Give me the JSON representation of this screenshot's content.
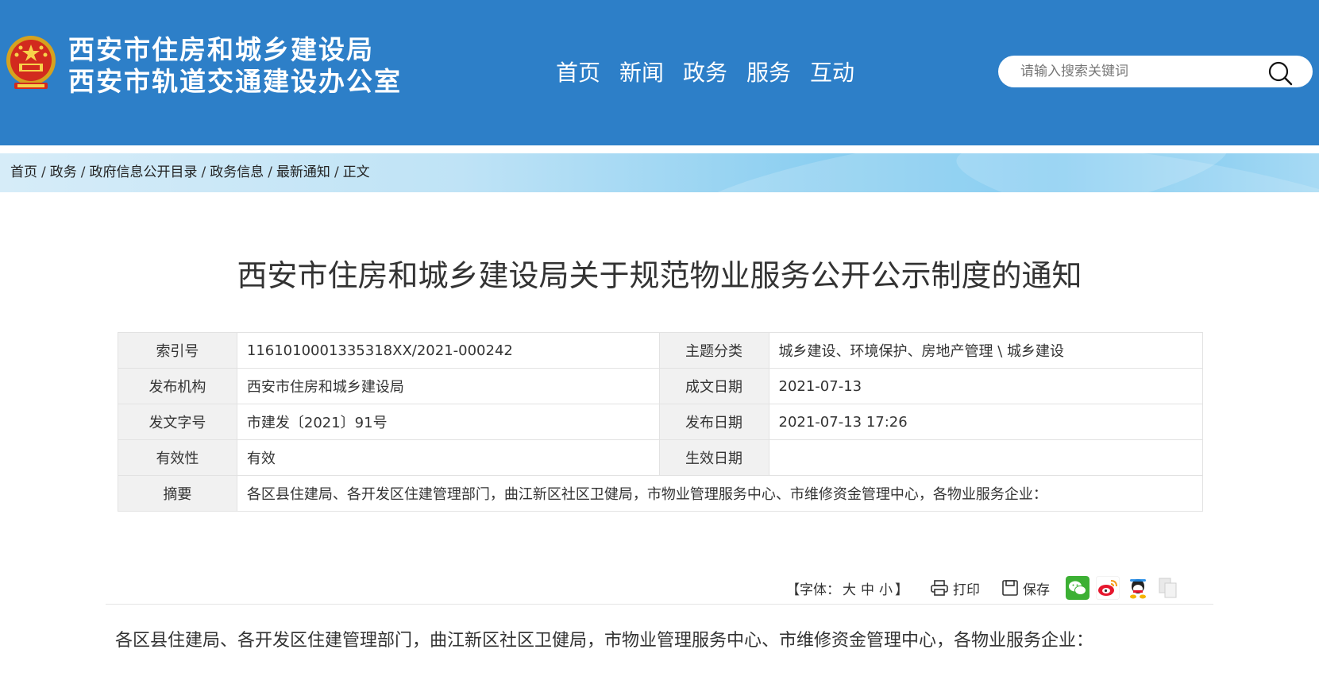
{
  "header": {
    "title_line1": "西安市住房和城乡建设局",
    "title_line2": "西安市轨道交通建设办公室",
    "nav": [
      "首页",
      "新闻",
      "政务",
      "服务",
      "互动"
    ],
    "search_placeholder": "请输入搜索关键词",
    "background_color": "#2d7fc8"
  },
  "breadcrumb": {
    "items": [
      "首页",
      "政务",
      "政府信息公开目录",
      "政务信息",
      "最新通知",
      "正文"
    ],
    "separator": "/"
  },
  "article": {
    "title": "西安市住房和城乡建设局关于规范物业服务公开公示制度的通知",
    "meta": {
      "index_label": "索引号",
      "index_value": "1161010001335318XX/2021-000242",
      "topic_label": "主题分类",
      "topic_value": "城乡建设、环境保护、房地产管理 \\ 城乡建设",
      "publisher_label": "发布机构",
      "publisher_value": "西安市住房和城乡建设局",
      "created_label": "成文日期",
      "created_value": "2021-07-13",
      "docno_label": "发文字号",
      "docno_value": "市建发〔2021〕91号",
      "published_label": "发布日期",
      "published_value": "2021-07-13 17:26",
      "validity_label": "有效性",
      "validity_value": "有效",
      "effective_label": "生效日期",
      "effective_value": "",
      "abstract_label": "摘要",
      "abstract_value": "各区县住建局、各开发区住建管理部门，曲江新区社区卫健局，市物业管理服务中心、市维修资金管理中心，各物业服务企业："
    },
    "tools": {
      "font_label_open": "【字体：",
      "font_large": "大",
      "font_medium": "中",
      "font_small": "小",
      "font_label_close": "】",
      "print_label": "打印",
      "save_label": "保存"
    },
    "body_first_line": "各区县住建局、各开发区住建管理部门，曲江新区社区卫健局，市物业管理服务中心、市维修资金管理中心，各物业服务企业："
  }
}
